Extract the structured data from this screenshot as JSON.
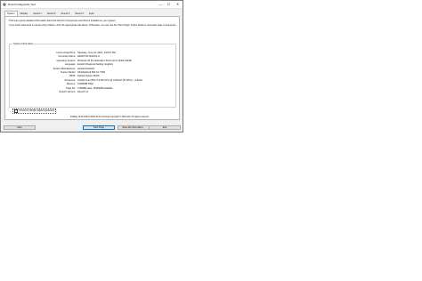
{
  "window": {
    "title": "DirectX Diagnostic Tool",
    "controls": {
      "minimize": "—",
      "maximize": "☐",
      "close": "✕"
    }
  },
  "tabs": [
    {
      "label": "System",
      "active": true
    },
    {
      "label": "Display"
    },
    {
      "label": "Sound 1"
    },
    {
      "label": "Sound 2"
    },
    {
      "label": "Sound 3"
    },
    {
      "label": "Sound 4"
    },
    {
      "label": "Input"
    }
  ],
  "intro": {
    "line1": "This tool reports detailed information about the DirectX components and drivers installed on your system.",
    "line2": "If you know what area is causing the problem, click the appropriate tab above. Otherwise, you can use the \"Next Page\" button below to visit each page in sequence."
  },
  "system_info": {
    "title": "System Information",
    "rows": [
      {
        "label": "Current Date/Time:",
        "value": "Saturday, June 24, 2023, 3:26:57 PM"
      },
      {
        "label": "Computer Name:",
        "value": "DESKTOP-9LRJOLG"
      },
      {
        "label": "Operating System:",
        "value": "Windows 10 Pro Education 64-bit (10.0, Build 19045)"
      },
      {
        "label": "Language:",
        "value": "English (Regional Setting: English)"
      },
      {
        "label": "System Manufacturer:",
        "value": "Hewlett-Packard"
      },
      {
        "label": "System Model:",
        "value": "HP EliteDesk 800 G1 TWR"
      },
      {
        "label": "BIOS:",
        "value": "Default System BIOS"
      },
      {
        "label": "Processor:",
        "value": "Intel(R) Core(TM) i7-4790 CPU @ 3.60GHz (8 CPUs), ~3.6GHz"
      },
      {
        "label": "Memory:",
        "value": "16384MB RAM"
      },
      {
        "label": "Page file:",
        "value": "7109MB used, 16433MB available"
      },
      {
        "label": "DirectX Version:",
        "value": "DirectX 12"
      }
    ]
  },
  "whql_checkbox": {
    "label": "Check for WHQL digital signatures",
    "checked": false
  },
  "copyright": "DxDiag 10.00.19041.1030 64-bit Unicode  Copyright © Microsoft. All rights reserved.",
  "buttons": {
    "help": "Help",
    "next_page": "Next Page",
    "save_all": "Save All Information...",
    "exit": "Exit"
  }
}
